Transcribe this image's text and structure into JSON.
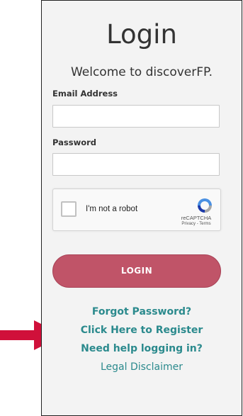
{
  "login": {
    "title": "Login",
    "welcome": "Welcome to discoverFP.",
    "email_label": "Email Address",
    "email_value": "",
    "password_label": "Password",
    "password_value": "",
    "recaptcha": {
      "label": "I'm not a robot",
      "brand": "reCAPTCHA",
      "terms": "Privacy - Terms"
    },
    "login_button": "LOGIN",
    "links": {
      "forgot": "Forgot Password?",
      "register": "Click Here to Register",
      "help": "Need help logging in?",
      "legal": "Legal Disclaimer"
    }
  },
  "colors": {
    "panel_bg": "#f3f3f3",
    "button": "#c05468",
    "link": "#2b8a8d",
    "arrow": "#d0103a"
  },
  "icons": {
    "annotation": "arrow-right-icon",
    "recaptcha": "recaptcha-logo-icon",
    "checkbox": "checkbox-icon"
  }
}
